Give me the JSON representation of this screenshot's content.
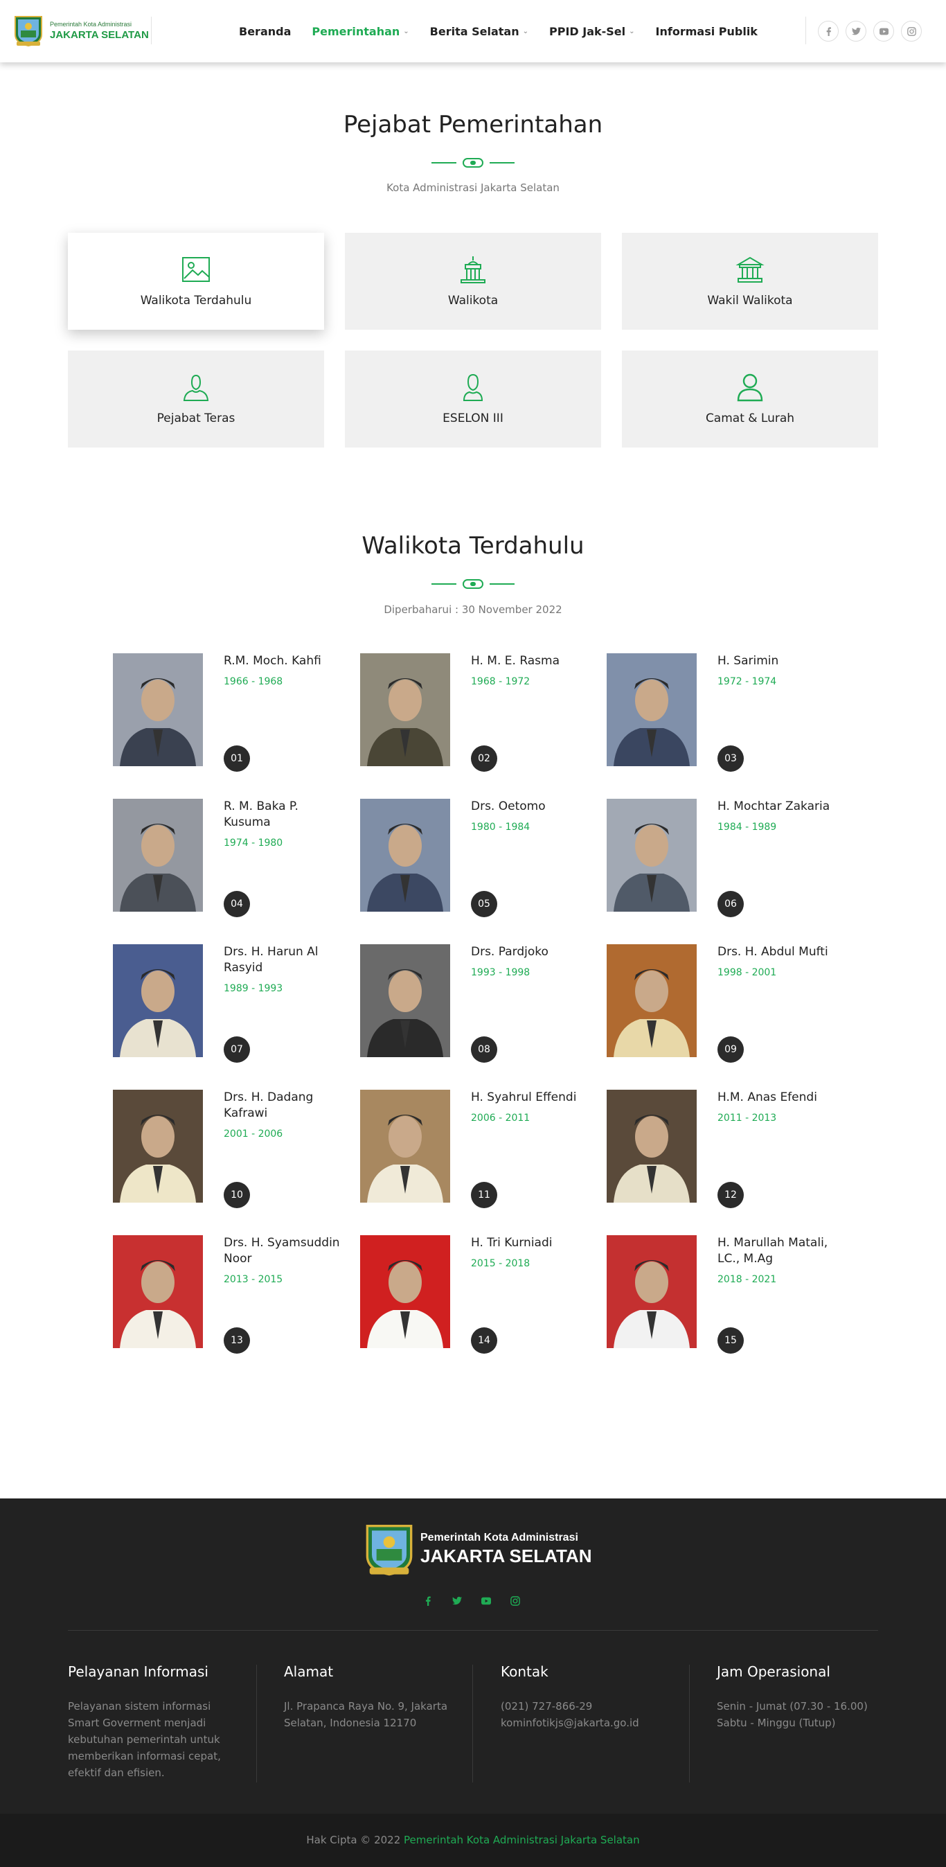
{
  "header": {
    "logo_small": "Pemerintah Kota Administrasi",
    "logo_big": "JAKARTA SELATAN",
    "nav": [
      {
        "label": "Beranda",
        "dropdown": false,
        "active": false
      },
      {
        "label": "Pemerintahan",
        "dropdown": true,
        "active": true
      },
      {
        "label": "Berita Selatan",
        "dropdown": true,
        "active": false
      },
      {
        "label": "PPID Jak-Sel",
        "dropdown": true,
        "active": false
      },
      {
        "label": "Informasi Publik",
        "dropdown": false,
        "active": false
      }
    ],
    "social_icons": [
      "facebook-icon",
      "twitter-icon",
      "youtube-icon",
      "instagram-icon"
    ]
  },
  "officials_section": {
    "title": "Pejabat Pemerintahan",
    "subtitle": "Kota Administrasi Jakarta Selatan",
    "categories": [
      {
        "label": "Walikota Terdahulu",
        "icon": "image-icon",
        "active": true
      },
      {
        "label": "Walikota",
        "icon": "building-icon",
        "active": false
      },
      {
        "label": "Wakil Walikota",
        "icon": "bank-icon",
        "active": false
      },
      {
        "label": "Pejabat Teras",
        "icon": "user-icon",
        "active": false
      },
      {
        "label": "ESELON III",
        "icon": "user-outline-icon",
        "active": false
      },
      {
        "label": "Camat & Lurah",
        "icon": "user-circle-icon",
        "active": false
      }
    ]
  },
  "former_mayors": {
    "title": "Walikota Terdahulu",
    "updated": "Diperbaharui : 30 November 2022",
    "people": [
      {
        "name": "R.M. Moch. Kahfi",
        "years": "1966 - 1968",
        "number": "01"
      },
      {
        "name": "H. M. E. Rasma",
        "years": "1968 - 1972",
        "number": "02"
      },
      {
        "name": "H. Sarimin",
        "years": "1972 - 1974",
        "number": "03"
      },
      {
        "name": "R. M. Baka P. Kusuma",
        "years": "1974 - 1980",
        "number": "04"
      },
      {
        "name": "Drs. Oetomo",
        "years": "1980 - 1984",
        "number": "05"
      },
      {
        "name": "H. Mochtar Zakaria",
        "years": "1984 - 1989",
        "number": "06"
      },
      {
        "name": "Drs. H. Harun Al Rasyid",
        "years": "1989 - 1993",
        "number": "07"
      },
      {
        "name": "Drs. Pardjoko",
        "years": "1993 - 1998",
        "number": "08"
      },
      {
        "name": "Drs. H. Abdul Mufti",
        "years": "1998 - 2001",
        "number": "09"
      },
      {
        "name": "Drs. H. Dadang Kafrawi",
        "years": "2001 - 2006",
        "number": "10"
      },
      {
        "name": "H. Syahrul Effendi",
        "years": "2006 - 2011",
        "number": "11"
      },
      {
        "name": "H.M. Anas Efendi",
        "years": "2011 - 2013",
        "number": "12"
      },
      {
        "name": "Drs. H. Syamsuddin Noor",
        "years": "2013 - 2015",
        "number": "13"
      },
      {
        "name": "H. Tri Kurniadi",
        "years": "2015 - 2018",
        "number": "14"
      },
      {
        "name": "H. Marullah Matali, LC., M.Ag",
        "years": "2018 - 2021",
        "number": "15"
      }
    ]
  },
  "footer": {
    "logo_small": "Pemerintah Kota Administrasi",
    "logo_big": "JAKARTA SELATAN",
    "social_icons": [
      "facebook-icon",
      "twitter-icon",
      "youtube-icon",
      "instagram-icon"
    ],
    "columns": [
      {
        "title": "Pelayanan Informasi",
        "text": "Pelayanan sistem informasi Smart Goverment menjadi kebutuhan pemerintah untuk memberikan informasi cepat, efektif dan efisien."
      },
      {
        "title": "Alamat",
        "text": "Jl. Prapanca Raya No. 9, Jakarta Selatan, Indonesia 12170"
      },
      {
        "title": "Kontak",
        "lines": [
          "(021) 727-866-29",
          "kominfotikjs@jakarta.go.id"
        ]
      },
      {
        "title": "Jam Operasional",
        "lines": [
          "Senin - Jumat (07.30 - 16.00)",
          "Sabtu - Minggu (Tutup)"
        ]
      }
    ],
    "copyright_prefix": "Hak Cipta © 2022",
    "copyright_link": "Pemerintah Kota Administrasi Jakarta Selatan"
  },
  "colors": {
    "accent": "#1fab54",
    "footer_bg": "#222222",
    "card_bg": "#f0f0f0"
  }
}
